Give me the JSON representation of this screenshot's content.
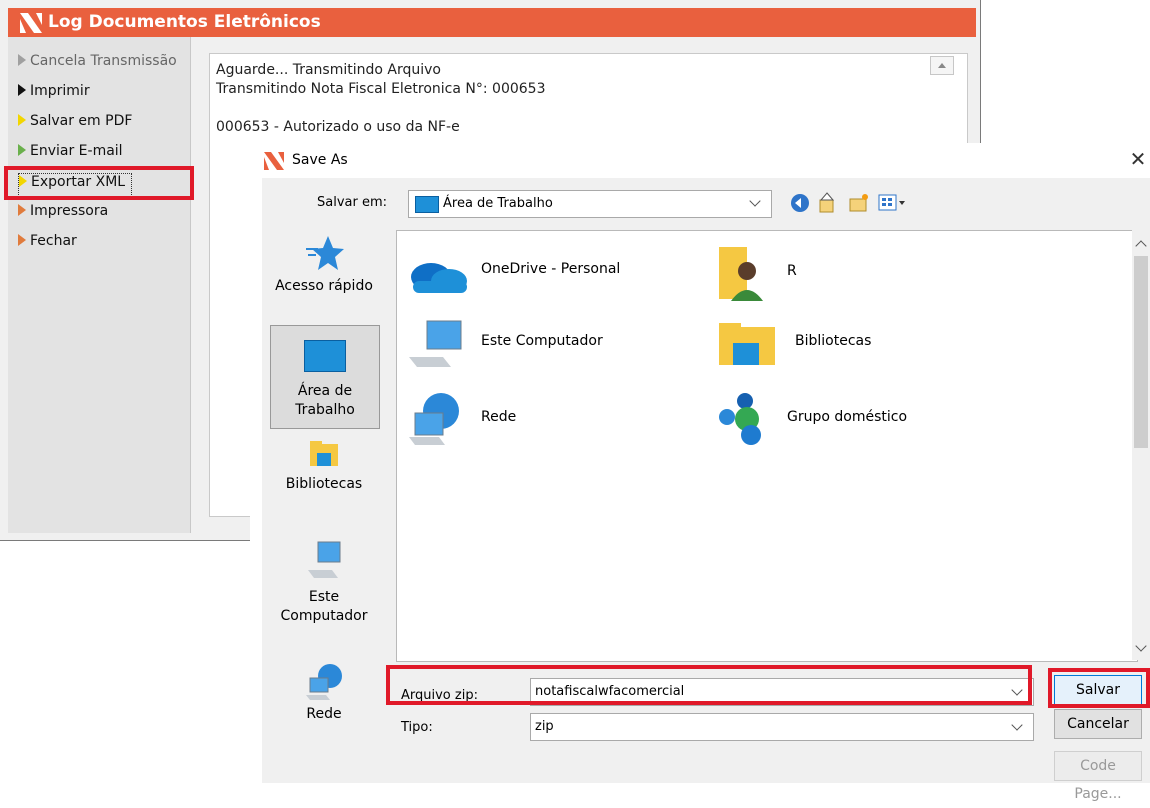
{
  "back_window": {
    "title": "Log Documentos Eletrônicos",
    "menu": [
      {
        "label": "Cancela Transmissão",
        "hot": "C",
        "rest": "ancela Transmissão",
        "color": "#8c8c8c"
      },
      {
        "label": "Imprimir",
        "hot": "I",
        "rest": "mprimir",
        "color": "#111111"
      },
      {
        "label": "Salvar em PDF",
        "pre": "Salvar em ",
        "hot": "P",
        "rest": "DF",
        "color": "#f2d600"
      },
      {
        "label": "Enviar E-mail",
        "hot": "E",
        "rest": "nviar E-mail",
        "color": "#6ab04c"
      },
      {
        "label": "Exportar XML",
        "hot": "E",
        "rest": "xportar XML",
        "color": "#f2d600"
      },
      {
        "label": "Impressora",
        "hot": "I",
        "rest": "mpressora",
        "color": "#e07b3c"
      },
      {
        "label": "Fechar",
        "hot": "F",
        "rest": "echar",
        "color": "#e07b3c"
      }
    ],
    "log_lines": [
      "Aguarde... Transmitindo Arquivo",
      "Transmitindo Nota Fiscal Eletronica N°: 000653",
      "",
      "000653 - Autorizado o uso da NF-e"
    ]
  },
  "dialog": {
    "title": "Save As",
    "save_in_label": "Salvar em:",
    "save_in_value": "Área de Trabalho",
    "places": [
      "Acesso rápido",
      "Área de Trabalho",
      "Bibliotecas",
      "Este Computador",
      "Rede"
    ],
    "files": [
      {
        "name": "OneDrive - Personal",
        "icon": "onedrive-icon"
      },
      {
        "name": "R",
        "icon": "user-folder-icon"
      },
      {
        "name": "Este Computador",
        "icon": "computer-icon"
      },
      {
        "name": "Bibliotecas",
        "icon": "libraries-icon"
      },
      {
        "name": "Rede",
        "icon": "network-icon"
      },
      {
        "name": "Grupo doméstico",
        "icon": "homegroup-icon"
      }
    ],
    "filename_label": "Arquivo zip:",
    "filename_value": "notafiscalwfacomercial",
    "type_label": "Tipo:",
    "type_value": "zip",
    "save_button": "Salvar",
    "cancel_button": "Cancelar",
    "codepage_button": "Code Page..."
  },
  "colors": {
    "brand": "#e9603e",
    "highlight": "#e01929",
    "desktop_blue": "#1e90d8"
  }
}
